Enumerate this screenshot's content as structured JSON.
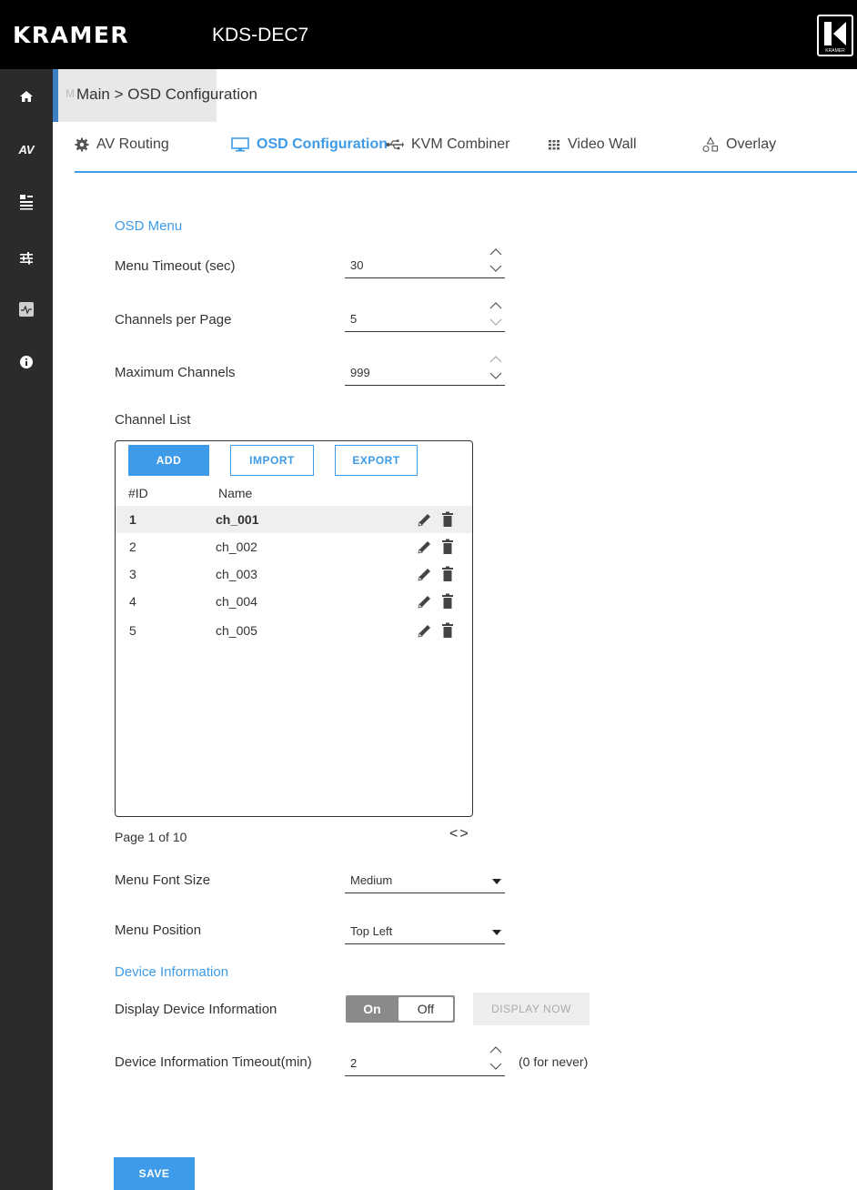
{
  "header": {
    "brand": "KRAMER",
    "model": "KDS-DEC7",
    "logo_text": "KRAMER"
  },
  "sidebar": {
    "items": [
      {
        "icon": "home-icon"
      },
      {
        "icon": "av-icon",
        "label": "AV"
      },
      {
        "icon": "settings-panel-icon"
      },
      {
        "icon": "sliders-icon"
      },
      {
        "icon": "diagnostics-icon"
      },
      {
        "icon": "info-icon"
      }
    ]
  },
  "breadcrumb": {
    "text": "Main > OSD Configuration",
    "ghost": "M"
  },
  "tabs": [
    {
      "label": "AV Routing",
      "icon": "gear-icon"
    },
    {
      "label": "OSD Configuration",
      "icon": "monitor-icon",
      "active": true
    },
    {
      "label": "KVM Combiner",
      "icon": "usb-icon"
    },
    {
      "label": "Video Wall",
      "icon": "grid-icon"
    },
    {
      "label": "Overlay",
      "icon": "overlay-icon"
    }
  ],
  "osd_menu": {
    "title": "OSD Menu",
    "menu_timeout": {
      "label": "Menu Timeout (sec)",
      "value": "30"
    },
    "channels_per_page": {
      "label": "Channels per Page",
      "value": "5"
    },
    "maximum_channels": {
      "label": "Maximum Channels",
      "value": "999"
    },
    "channel_list": {
      "label": "Channel List",
      "buttons": {
        "add": "ADD",
        "import": "IMPORT",
        "export": "EXPORT"
      },
      "columns": {
        "id": "#ID",
        "name": "Name"
      },
      "rows": [
        {
          "id": "1",
          "name": "ch_001"
        },
        {
          "id": "2",
          "name": "ch_002"
        },
        {
          "id": "3",
          "name": "ch_003"
        },
        {
          "id": "4",
          "name": "ch_004"
        },
        {
          "id": "5",
          "name": "ch_005"
        }
      ],
      "pager": "Page 1 of 10",
      "pager_nav": "<>"
    },
    "menu_font_size": {
      "label": "Menu Font Size",
      "value": "Medium"
    },
    "menu_position": {
      "label": "Menu Position",
      "value": "Top Left"
    }
  },
  "device_information": {
    "title": "Device Information",
    "display_label": "Display Device Information",
    "toggle_on": "On",
    "toggle_off": "Off",
    "display_now": "DISPLAY NOW",
    "timeout_label": "Device Information Timeout(min)",
    "timeout_value": "2",
    "timeout_hint": "(0 for never)"
  },
  "save_label": "SAVE",
  "colors": {
    "accent": "#3d9be9",
    "header_bg": "#000000",
    "sidebar_bg": "#2b2b2b"
  }
}
